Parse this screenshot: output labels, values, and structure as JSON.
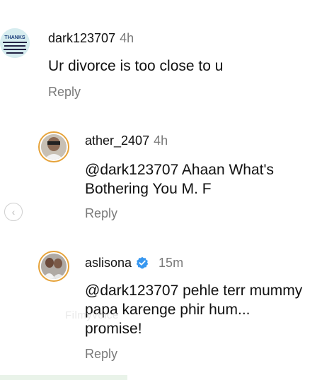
{
  "comments": [
    {
      "username": "dark123707",
      "time": "4h",
      "text_lines": [
        "Ur divorce is too close to u"
      ],
      "reply_label": "Reply",
      "avatar_text": [
        "THANKS"
      ]
    },
    {
      "username": "ather_2407",
      "time": "4h",
      "text_lines": [
        "@dark123707 Ahaan What's",
        "Bothering You M. F"
      ],
      "reply_label": "Reply"
    },
    {
      "username": "aslisona",
      "time": "15m",
      "verified": true,
      "text_lines": [
        "@dark123707 pehle terr mummy",
        "papa karenge phir hum...",
        "promise!"
      ],
      "reply_label": "Reply"
    }
  ],
  "colors": {
    "story_ring": "#e6a33a",
    "verified_badge": "#3797f0",
    "meta_gray": "#7a7a7a"
  },
  "watermark": "Filmyvoice"
}
